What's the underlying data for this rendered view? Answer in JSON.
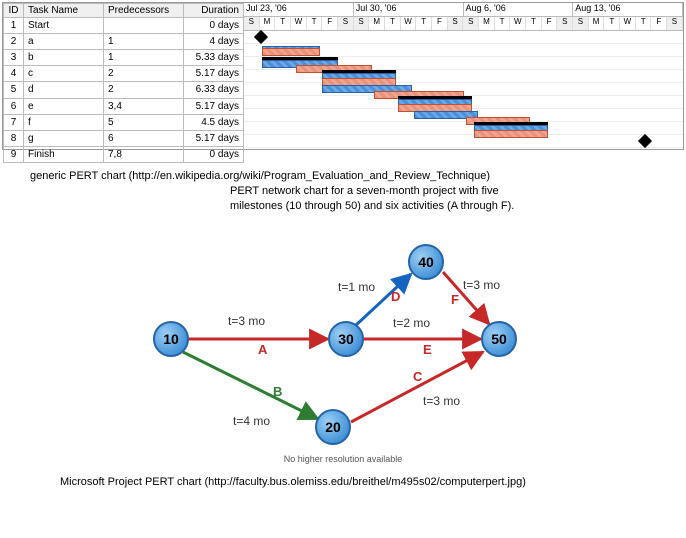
{
  "gantt": {
    "headers": {
      "id": "ID",
      "name": "Task Name",
      "pred": "Predecessors",
      "dur": "Duration"
    },
    "weeks": [
      "Jul 23, '06",
      "Jul 30, '06",
      "Aug 6, '06",
      "Aug 13, '06"
    ],
    "days": [
      "S",
      "M",
      "T",
      "W",
      "T",
      "F",
      "S",
      "S",
      "M",
      "T",
      "W",
      "T",
      "F",
      "S",
      "S",
      "M",
      "T",
      "W",
      "T",
      "F",
      "S",
      "S",
      "M",
      "T",
      "W",
      "T",
      "F",
      "S"
    ],
    "rows": [
      {
        "id": "1",
        "name": "Start",
        "pred": "",
        "dur": "0 days"
      },
      {
        "id": "2",
        "name": "a",
        "pred": "1",
        "dur": "4 days"
      },
      {
        "id": "3",
        "name": "b",
        "pred": "1",
        "dur": "5.33 days"
      },
      {
        "id": "4",
        "name": "c",
        "pred": "2",
        "dur": "5.17 days"
      },
      {
        "id": "5",
        "name": "d",
        "pred": "2",
        "dur": "6.33 days"
      },
      {
        "id": "6",
        "name": "e",
        "pred": "3,4",
        "dur": "5.17 days"
      },
      {
        "id": "7",
        "name": "f",
        "pred": "5",
        "dur": "4.5 days"
      },
      {
        "id": "8",
        "name": "g",
        "pred": "6",
        "dur": "5.17 days"
      },
      {
        "id": "9",
        "name": "Finish",
        "pred": "7,8",
        "dur": "0 days"
      }
    ]
  },
  "text1": "generic PERT chart   (http://en.wikipedia.org/wiki/Program_Evaluation_and_Review_Technique)",
  "caption1": "PERT network chart for a seven-month project with five",
  "caption2": "milestones (10 through 50) and six activities (A through F).",
  "pert": {
    "nodes": {
      "10": "10",
      "20": "20",
      "30": "30",
      "40": "40",
      "50": "50"
    },
    "edges": {
      "A": {
        "label": "A",
        "time": "t=3 mo"
      },
      "B": {
        "label": "B",
        "time": "t=4 mo"
      },
      "C": {
        "label": "C",
        "time": "t=3 mo"
      },
      "D": {
        "label": "D",
        "time": "t=1 mo"
      },
      "E": {
        "label": "E",
        "time": "t=2 mo"
      },
      "F": {
        "label": "F",
        "time": "t=3 mo"
      }
    }
  },
  "small_note": "No higher resolution available",
  "footer": "Microsoft Project PERT chart   (http://faculty.bus.olemiss.edu/breithel/m495s02/computerpert.jpg)",
  "chart_data": {
    "type": "network",
    "title": "PERT network chart for a seven-month project",
    "nodes": [
      10,
      20,
      30,
      40,
      50
    ],
    "edges": [
      {
        "name": "A",
        "from": 10,
        "to": 30,
        "duration_months": 3
      },
      {
        "name": "B",
        "from": 10,
        "to": 20,
        "duration_months": 4
      },
      {
        "name": "C",
        "from": 20,
        "to": 50,
        "duration_months": 3
      },
      {
        "name": "D",
        "from": 30,
        "to": 40,
        "duration_months": 1
      },
      {
        "name": "E",
        "from": 30,
        "to": 50,
        "duration_months": 2
      },
      {
        "name": "F",
        "from": 40,
        "to": 50,
        "duration_months": 3
      }
    ]
  }
}
